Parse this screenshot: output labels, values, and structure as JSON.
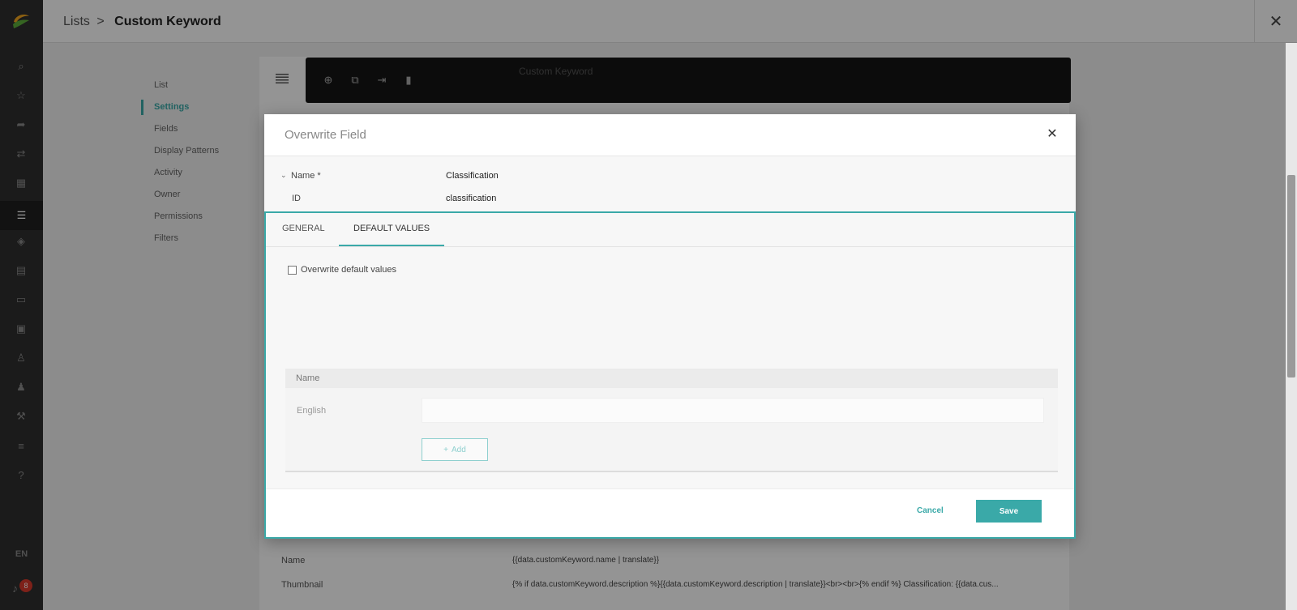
{
  "header": {
    "breadcrumb_root": "Lists",
    "breadcrumb_sep": ">",
    "breadcrumb_current": "Custom Keyword"
  },
  "rail": {
    "icons": [
      "search-icon",
      "star-icon",
      "share-icon",
      "transfer-icon",
      "grid-icon",
      "list-icon",
      "layers-icon",
      "document-icon",
      "card-icon",
      "wallet-icon",
      "user-check-icon",
      "users-icon",
      "wrench-icon",
      "sliders-icon",
      "help-icon"
    ],
    "language": "EN",
    "notification_count": "8"
  },
  "subnav": {
    "items": [
      "List",
      "Settings",
      "Fields",
      "Display Patterns",
      "Activity",
      "Owner",
      "Permissions",
      "Filters"
    ],
    "active": "Settings"
  },
  "background": {
    "toolbar_title": "Custom Keyword",
    "rows": [
      {
        "label": "Name",
        "value": "{{data.customKeyword.name | translate}}"
      },
      {
        "label": "Thumbnail",
        "value": "{% if data.customKeyword.description %}{{data.customKeyword.description | translate}}<br><br>{% endif %} Classification: {{data.cus..."
      }
    ]
  },
  "modal": {
    "title": "Overwrite Field",
    "name_label": "Name *",
    "name_value": "Classification",
    "id_label": "ID",
    "id_value": "classification",
    "tabs": [
      "GENERAL",
      "DEFAULT VALUES"
    ],
    "active_tab": "DEFAULT VALUES",
    "checkbox_label": "Overwrite default values",
    "checkbox_checked": false,
    "field_header": "Name",
    "language_label": "English",
    "language_value": "",
    "add_label": "Add",
    "cancel_label": "Cancel",
    "save_label": "Save"
  },
  "colors": {
    "accent": "#3aa9a8",
    "rail": "#2f2f2f",
    "badge": "#d93a2b"
  }
}
